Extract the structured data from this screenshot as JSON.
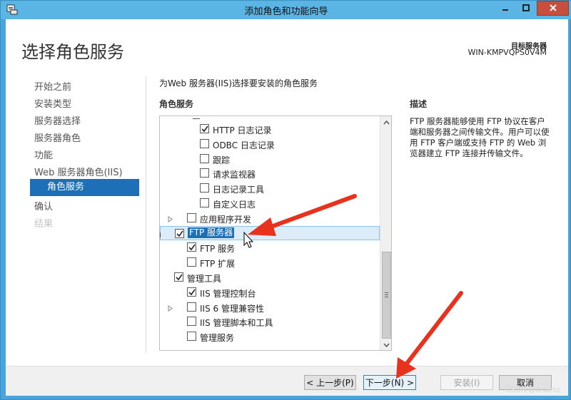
{
  "window": {
    "title": "添加角色和功能向导",
    "controls": {
      "minimize_icon": "minimize-icon",
      "maximize_icon": "maximize-icon",
      "close_icon": "close-icon"
    }
  },
  "header": {
    "title": "选择角色服务",
    "server_label": "目标服务器",
    "server_name": "WIN-KMPVQPS0V4M"
  },
  "nav": {
    "items": [
      {
        "label": "开始之前",
        "state": "normal"
      },
      {
        "label": "安装类型",
        "state": "normal"
      },
      {
        "label": "服务器选择",
        "state": "normal"
      },
      {
        "label": "服务器角色",
        "state": "normal"
      },
      {
        "label": "功能",
        "state": "normal"
      },
      {
        "label": "Web 服务器角色(IIS)",
        "state": "normal"
      },
      {
        "label": "角色服务",
        "state": "active"
      },
      {
        "label": "确认",
        "state": "normal"
      },
      {
        "label": "结果",
        "state": "disabled"
      }
    ]
  },
  "main": {
    "instruction": "为Web 服务器(IIS)选择要安装的角色服务",
    "role_services_heading": "角色服务",
    "tree": [
      {
        "label": "HTTP 日志记录",
        "checked": true,
        "level": 3,
        "expander": "none"
      },
      {
        "label": "ODBC 日志记录",
        "checked": false,
        "level": 3,
        "expander": "none"
      },
      {
        "label": "跟踪",
        "checked": false,
        "level": 3,
        "expander": "none"
      },
      {
        "label": "请求监视器",
        "checked": false,
        "level": 3,
        "expander": "none"
      },
      {
        "label": "日志记录工具",
        "checked": false,
        "level": 3,
        "expander": "none"
      },
      {
        "label": "自定义日志",
        "checked": false,
        "level": 3,
        "expander": "none"
      },
      {
        "label": "应用程序开发",
        "checked": false,
        "level": 2,
        "expander": "collapsed"
      },
      {
        "label": "FTP 服务器",
        "checked": true,
        "level": 1,
        "expander": "expanded",
        "selected": true
      },
      {
        "label": "FTP 服务",
        "checked": true,
        "level": 2,
        "expander": "none"
      },
      {
        "label": "FTP 扩展",
        "checked": false,
        "level": 2,
        "expander": "none"
      },
      {
        "label": "管理工具",
        "checked": true,
        "level": 1,
        "expander": "expanded"
      },
      {
        "label": "IIS 管理控制台",
        "checked": true,
        "level": 2,
        "expander": "none"
      },
      {
        "label": "IIS 6 管理兼容性",
        "checked": false,
        "level": 2,
        "expander": "collapsed"
      },
      {
        "label": "IIS 管理脚本和工具",
        "checked": false,
        "level": 2,
        "expander": "none"
      },
      {
        "label": "管理服务",
        "checked": false,
        "level": 2,
        "expander": "none"
      }
    ],
    "description_heading": "描述",
    "description": "FTP 服务器能够使用 FTP 协议在客户端和服务器之间传输文件。用户可以使用 FTP 客户端或支持 FTP 的 Web 浏览器建立 FTP 连接并传输文件。"
  },
  "footer": {
    "prev_label": "< 上一步(P)",
    "next_label": "下一步(N) >",
    "install_label": "安装(I)",
    "cancel_label": "取消"
  },
  "watermark": "CSDN @Duarte",
  "colors": {
    "titlebar": "#5ab4e4",
    "frame": "#4aa3d9",
    "accent": "#1d6fb8",
    "annotation_arrow": "#e8321e"
  }
}
